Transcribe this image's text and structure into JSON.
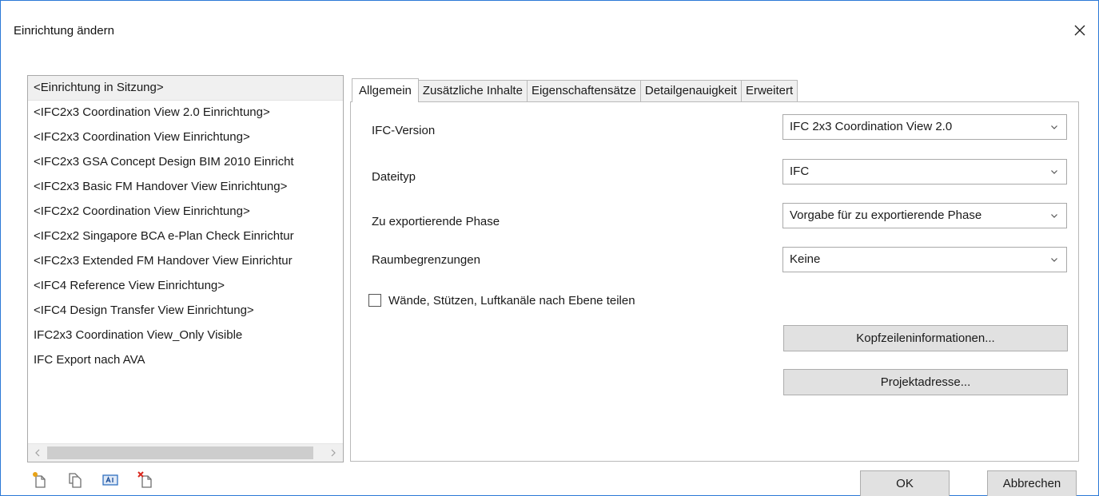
{
  "dialog": {
    "title": "Einrichtung ändern"
  },
  "setups": {
    "items": [
      "<Einrichtung in Sitzung>",
      "<IFC2x3 Coordination View 2.0 Einrichtung>",
      "<IFC2x3 Coordination View Einrichtung>",
      "<IFC2x3 GSA Concept Design BIM 2010 Einricht",
      "<IFC2x3 Basic FM Handover View Einrichtung>",
      "<IFC2x2 Coordination View Einrichtung>",
      "<IFC2x2 Singapore BCA e-Plan Check Einrichtur",
      "<IFC2x3 Extended FM Handover View Einrichtur",
      "<IFC4 Reference View Einrichtung>",
      "<IFC4 Design Transfer View Einrichtung>",
      "IFC2x3 Coordination View_Only Visible",
      "IFC Export nach AVA"
    ],
    "selected_index": 0
  },
  "toolbar_icons": [
    "new-setup-icon",
    "duplicate-setup-icon",
    "rename-setup-icon",
    "delete-setup-icon"
  ],
  "tabs": [
    {
      "label": "Allgemein",
      "active": true
    },
    {
      "label": "Zusätzliche Inhalte",
      "active": false
    },
    {
      "label": "Eigenschaftensätze",
      "active": false
    },
    {
      "label": "Detailgenauigkeit",
      "active": false
    },
    {
      "label": "Erweitert",
      "active": false
    }
  ],
  "general": {
    "ifc_version": {
      "label": "IFC-Version",
      "value": "IFC 2x3 Coordination View 2.0"
    },
    "file_type": {
      "label": "Dateityp",
      "value": "IFC"
    },
    "phase": {
      "label": "Zu exportierende Phase",
      "value": "Vorgabe für zu exportierende Phase"
    },
    "space_boundaries": {
      "label": "Raumbegrenzungen",
      "value": "Keine"
    },
    "split_walls": {
      "label": "Wände, Stützen, Luftkanäle nach Ebene teilen",
      "checked": false
    },
    "header_info_button": "Kopfzeileninformationen...",
    "project_address_button": "Projektadresse..."
  },
  "footer": {
    "ok": "OK",
    "cancel": "Abbrechen"
  },
  "colors": {
    "window_border": "#2b79d6",
    "selection": "#f0f0f0",
    "button_face": "#e1e1e1"
  }
}
